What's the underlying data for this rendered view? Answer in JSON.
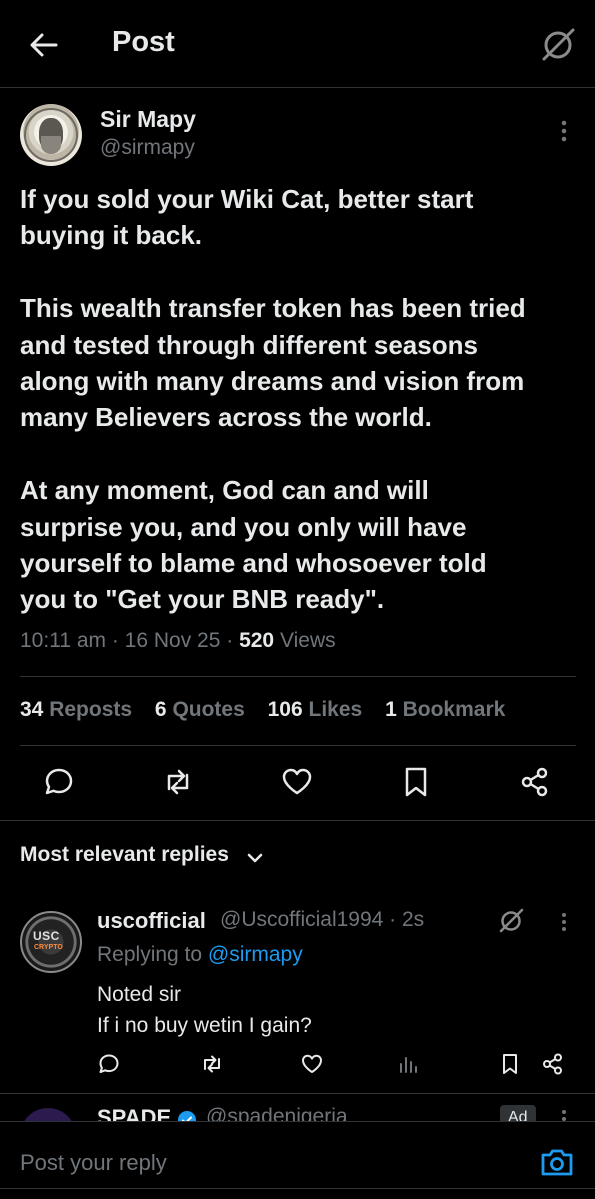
{
  "header": {
    "title": "Post"
  },
  "author": {
    "name": "Sir Mapy",
    "handle": "@sirmapy"
  },
  "post": {
    "paragraphs": [
      [
        "If you sold your Wiki Cat, better start",
        "buying it back."
      ],
      [
        "This wealth transfer token has been tried",
        "and tested through different seasons",
        "along with many dreams and vision from",
        "many Believers across the world."
      ],
      [
        "At any moment, God can and will",
        "surprise you, and you only will have",
        "yourself to blame and whosoever told",
        "you to \"Get your BNB ready\"."
      ]
    ],
    "time": "10:11 am",
    "date": "16 Nov 25",
    "views_count": "520",
    "views_label": "Views"
  },
  "stats": {
    "reposts_count": "34",
    "reposts_label": "Reposts",
    "quotes_count": "6",
    "quotes_label": "Quotes",
    "likes_count": "106",
    "likes_label": "Likes",
    "bookmarks_count": "1",
    "bookmarks_label": "Bookmark"
  },
  "replies_sort": {
    "label": "Most relevant replies"
  },
  "reply": {
    "name": "uscofficial",
    "handle_time": "@Uscofficial1994 · 2s",
    "replying_prefix": "Replying to ",
    "replying_to": "@sirmapy",
    "text_line1": "Noted sir",
    "text_line2": "If i no buy wetin I gain?",
    "avatar_text": "USC",
    "avatar_subtext": "CRYPTO"
  },
  "next_reply": {
    "name": "SPADE",
    "handle": "@spadenigeria",
    "badge": "Ad"
  },
  "composer": {
    "placeholder": "Post your reply"
  },
  "colors": {
    "background": "#000000",
    "text": "#e7e9ea",
    "muted": "#71767b",
    "accent": "#1d9bf0",
    "divider": "#2f3336"
  },
  "icons": [
    "back-arrow-icon",
    "grok-icon",
    "more-icon",
    "reply-icon",
    "repost-icon",
    "like-icon",
    "bookmark-icon",
    "share-icon",
    "chevron-down-icon",
    "analytics-icon",
    "verified-icon",
    "camera-icon"
  ]
}
